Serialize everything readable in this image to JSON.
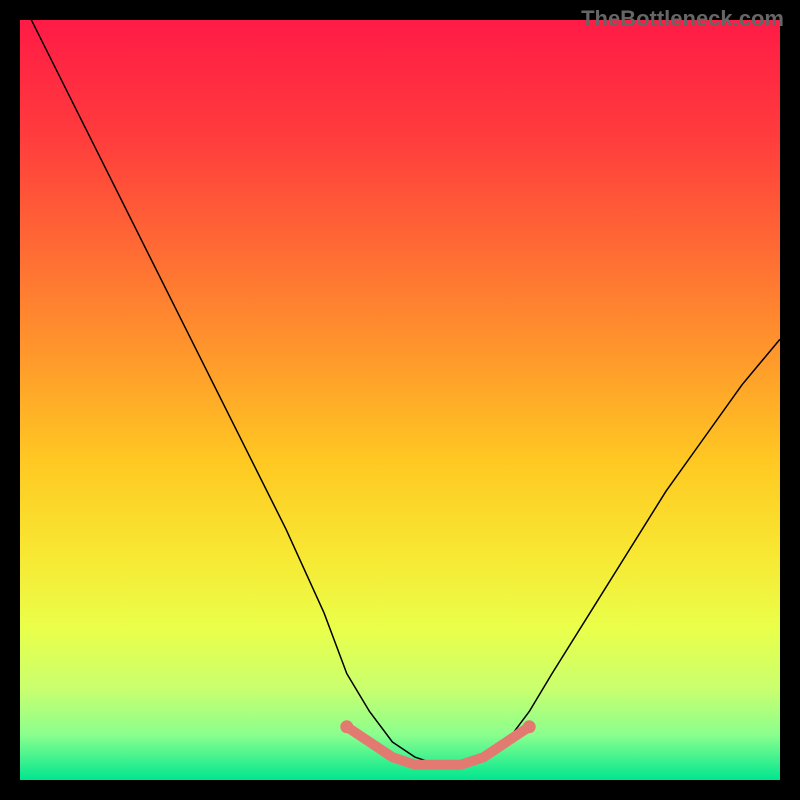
{
  "watermark": "TheBottleneck.com",
  "chart_data": {
    "type": "line",
    "title": "",
    "xlabel": "",
    "ylabel": "",
    "xlim": [
      0,
      100
    ],
    "ylim": [
      0,
      100
    ],
    "grid": false,
    "background": {
      "type": "vertical-gradient",
      "stops": [
        {
          "offset": 0.0,
          "color": "#ff1b46"
        },
        {
          "offset": 0.15,
          "color": "#ff3b3d"
        },
        {
          "offset": 0.3,
          "color": "#ff6a34"
        },
        {
          "offset": 0.45,
          "color": "#ff9b2b"
        },
        {
          "offset": 0.58,
          "color": "#ffc822"
        },
        {
          "offset": 0.7,
          "color": "#f8e732"
        },
        {
          "offset": 0.8,
          "color": "#eaff4a"
        },
        {
          "offset": 0.88,
          "color": "#c9ff6e"
        },
        {
          "offset": 0.94,
          "color": "#8bff8e"
        },
        {
          "offset": 1.0,
          "color": "#00e68f"
        }
      ]
    },
    "series": [
      {
        "name": "bottleneck-curve",
        "color": "#000000",
        "stroke_width": 1.5,
        "x": [
          0,
          5,
          10,
          15,
          20,
          25,
          30,
          35,
          40,
          43,
          46,
          49,
          52,
          55,
          58,
          61,
          64,
          67,
          70,
          75,
          80,
          85,
          90,
          95,
          100
        ],
        "y": [
          103,
          93,
          83,
          73,
          63,
          53,
          43,
          33,
          22,
          14,
          9,
          5,
          3,
          2,
          2,
          3,
          5,
          9,
          14,
          22,
          30,
          38,
          45,
          52,
          58
        ]
      },
      {
        "name": "optimal-band-highlight",
        "color": "#e27a72",
        "stroke_width": 10,
        "x": [
          43,
          46,
          49,
          52,
          55,
          58,
          61,
          64,
          67
        ],
        "y": [
          7,
          5,
          3,
          2,
          2,
          2,
          3,
          5,
          7
        ]
      }
    ]
  },
  "colors": {
    "frame_bg": "#000000",
    "watermark": "#666666"
  }
}
